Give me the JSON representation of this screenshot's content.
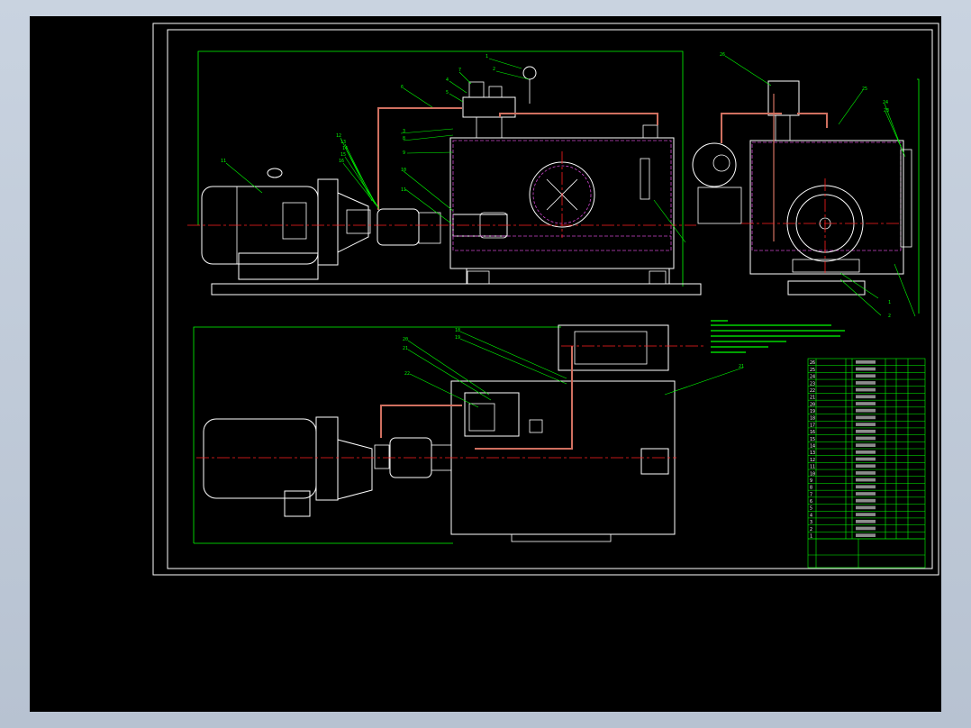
{
  "drawing": {
    "colors": {
      "background": "#000000",
      "outline": "#ffffff",
      "dimension": "#00ff00",
      "centerline": "#ff2020",
      "pipe": "#d07060",
      "hidden": "#cc44cc",
      "desktop": "#c0cad8"
    },
    "balloons_front": [
      "1",
      "2",
      "3",
      "4",
      "5",
      "6",
      "7",
      "8",
      "9",
      "10",
      "11",
      "12",
      "13",
      "14",
      "15",
      "16",
      "17"
    ],
    "balloons_side": [
      "26",
      "25",
      "24",
      "23",
      "1",
      "2"
    ],
    "balloons_plan": [
      "20",
      "21",
      "22",
      "18",
      "19",
      "21"
    ],
    "title_block": {
      "rows": [
        "26",
        "25",
        "24",
        "23",
        "22",
        "21",
        "20",
        "19",
        "18",
        "17",
        "16",
        "15",
        "14",
        "13",
        "12",
        "11",
        "10",
        "9",
        "8",
        "7",
        "6",
        "5",
        "4",
        "3",
        "2",
        "1"
      ]
    }
  }
}
